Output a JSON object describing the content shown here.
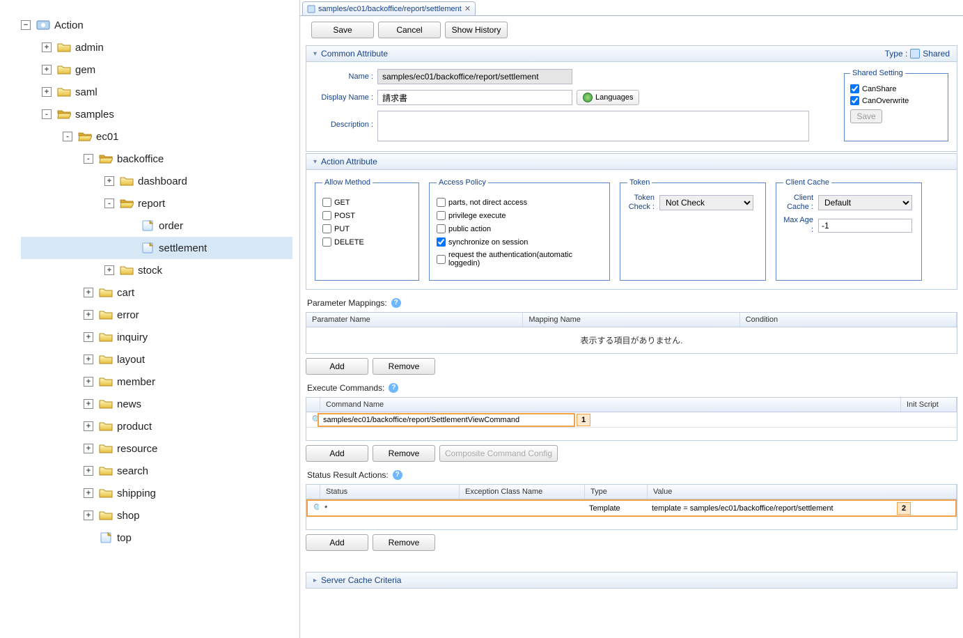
{
  "tree": {
    "root": {
      "label": "Action"
    },
    "nodes": [
      {
        "label": "admin",
        "indent": 1,
        "exp": "+",
        "icon": "folder"
      },
      {
        "label": "gem",
        "indent": 1,
        "exp": "+",
        "icon": "folder"
      },
      {
        "label": "saml",
        "indent": 1,
        "exp": "+",
        "icon": "folder"
      },
      {
        "label": "samples",
        "indent": 1,
        "exp": "-",
        "icon": "folder-open"
      },
      {
        "label": "ec01",
        "indent": 2,
        "exp": "-",
        "icon": "folder-open"
      },
      {
        "label": "backoffice",
        "indent": 3,
        "exp": "-",
        "icon": "folder-open"
      },
      {
        "label": "dashboard",
        "indent": 4,
        "exp": "+",
        "icon": "folder"
      },
      {
        "label": "report",
        "indent": 4,
        "exp": "-",
        "icon": "folder-open"
      },
      {
        "label": "order",
        "indent": 5,
        "exp": " ",
        "icon": "page"
      },
      {
        "label": "settlement",
        "indent": 5,
        "exp": " ",
        "icon": "page",
        "selected": true
      },
      {
        "label": "stock",
        "indent": 4,
        "exp": "+",
        "icon": "folder"
      },
      {
        "label": "cart",
        "indent": 3,
        "exp": "+",
        "icon": "folder"
      },
      {
        "label": "error",
        "indent": 3,
        "exp": "+",
        "icon": "folder"
      },
      {
        "label": "inquiry",
        "indent": 3,
        "exp": "+",
        "icon": "folder"
      },
      {
        "label": "layout",
        "indent": 3,
        "exp": "+",
        "icon": "folder"
      },
      {
        "label": "member",
        "indent": 3,
        "exp": "+",
        "icon": "folder"
      },
      {
        "label": "news",
        "indent": 3,
        "exp": "+",
        "icon": "folder"
      },
      {
        "label": "product",
        "indent": 3,
        "exp": "+",
        "icon": "folder"
      },
      {
        "label": "resource",
        "indent": 3,
        "exp": "+",
        "icon": "folder"
      },
      {
        "label": "search",
        "indent": 3,
        "exp": "+",
        "icon": "folder"
      },
      {
        "label": "shipping",
        "indent": 3,
        "exp": "+",
        "icon": "folder"
      },
      {
        "label": "shop",
        "indent": 3,
        "exp": "+",
        "icon": "folder"
      },
      {
        "label": "top",
        "indent": 3,
        "exp": " ",
        "icon": "page"
      }
    ]
  },
  "tab": {
    "title": "samples/ec01/backoffice/report/settlement"
  },
  "toolbar": {
    "save": "Save",
    "cancel": "Cancel",
    "history": "Show History"
  },
  "common": {
    "title": "Common Attribute",
    "type_label": "Type :",
    "type_value": "Shared",
    "name_label": "Name :",
    "name_value": "samples/ec01/backoffice/report/settlement",
    "display_name_label": "Display Name :",
    "display_name_value": "請求書",
    "languages": "Languages",
    "description_label": "Description :",
    "shared": {
      "legend": "Shared Setting",
      "can_share": "CanShare",
      "can_overwrite": "CanOverwrite",
      "save": "Save"
    }
  },
  "action": {
    "title": "Action Attribute",
    "allow_method": {
      "legend": "Allow Method",
      "get": "GET",
      "post": "POST",
      "put": "PUT",
      "delete": "DELETE"
    },
    "access_policy": {
      "legend": "Access Policy",
      "parts": "parts, not direct access",
      "privilege": "privilege execute",
      "public": "public action",
      "sync": "synchronize on session",
      "auth": "request the authentication(automatic loggedin)"
    },
    "token": {
      "legend": "Token",
      "check_label": "Token Check :",
      "check_value": "Not Check"
    },
    "cache": {
      "legend": "Client Cache",
      "client_cache_label": "Client Cache :",
      "client_cache_value": "Default",
      "max_age_label": "Max Age :",
      "max_age_value": "-1"
    }
  },
  "param_mappings": {
    "label": "Parameter Mappings:",
    "cols": {
      "name": "Paramater Name",
      "mapping": "Mapping Name",
      "condition": "Condition"
    },
    "empty": "表示する項目がありません.",
    "add": "Add",
    "remove": "Remove"
  },
  "commands": {
    "label": "Execute Commands:",
    "cols": {
      "name": "Command Name",
      "init": "Init Script"
    },
    "row": {
      "name": "samples/ec01/backoffice/report/SettlementViewCommand",
      "badge": "1"
    },
    "add": "Add",
    "remove": "Remove",
    "composite": "Composite Command Config"
  },
  "status_results": {
    "label": "Status Result Actions:",
    "cols": {
      "status": "Status",
      "exception": "Exception Class Name",
      "type": "Type",
      "value": "Value"
    },
    "row": {
      "status": "*",
      "exception": "",
      "type": "Template",
      "value": "template = samples/ec01/backoffice/report/settlement",
      "badge": "2"
    },
    "add": "Add",
    "remove": "Remove"
  },
  "server_cache": {
    "title": "Server Cache Criteria"
  }
}
